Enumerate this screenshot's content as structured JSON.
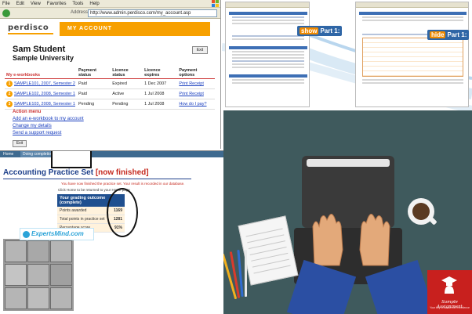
{
  "browser": {
    "menu": [
      "File",
      "Edit",
      "View",
      "Favorites",
      "Tools",
      "Help"
    ],
    "address_label": "Address",
    "url": "http://www.admin.perdisco.com/my_account.asp"
  },
  "site": {
    "logo": "perdisco",
    "section": "MY ACCOUNT",
    "student_name": "Sam Student",
    "university": "Sample University",
    "exit_label": "Exit",
    "table": {
      "headers": [
        "My e-workbooks",
        "Payment status",
        "Licence status",
        "Licence expires",
        "Payment options"
      ],
      "rows": [
        {
          "num": "1",
          "workbook": "SAMPLE101, 2007, Semester 2",
          "payment": "Paid",
          "licence": "Expired",
          "expires": "1 Dec 2007",
          "option": "Print Receipt"
        },
        {
          "num": "2",
          "workbook": "SAMPLE102, 2008, Semester 1",
          "payment": "Paid",
          "licence": "Active",
          "expires": "1 Jul 2008",
          "option": "Print Receipt"
        },
        {
          "num": "3",
          "workbook": "SAMPLE103, 2008, Semester 1",
          "payment": "Pending",
          "licence": "Pending",
          "expires": "1 Jul 2008",
          "option": "How do I pay?"
        }
      ]
    },
    "action_menu_title": "Action menu",
    "action_links": [
      "Add an e-workbook to my account",
      "Change my details",
      "Send a support request"
    ]
  },
  "panels": {
    "show_tag": "show",
    "show_label": "Part 1:",
    "hide_tag": "hide",
    "hide_label": "Part 1:"
  },
  "practice": {
    "nav_home": "Home",
    "nav_doing": "Doing completion",
    "title": "Accounting Practice Set",
    "status": "[now finished]",
    "message": "You have now finished the practice set. Your result is recorded in our database.",
    "click_hint": "Click Home to be returned to your Home page",
    "grade_head": "Your grading outcome (complete)",
    "grades": [
      {
        "label": "Points awarded",
        "value": "1169"
      },
      {
        "label": "Total points in practice set",
        "value": "1281"
      },
      {
        "label": "Percentage score",
        "value": "91%"
      }
    ],
    "watermark": "ExpertsMind.com"
  },
  "illustration": {
    "brand": "Sample Assignment",
    "tagline": "Your key to academic excellence"
  },
  "colors": {
    "perdisco_orange": "#f7a000",
    "link_blue": "#1a3fbf",
    "practice_blue": "#1d3f8a",
    "finished_red": "#c62a1f",
    "illustration_bg": "#3f5a5d",
    "brand_red": "#c8201e"
  }
}
